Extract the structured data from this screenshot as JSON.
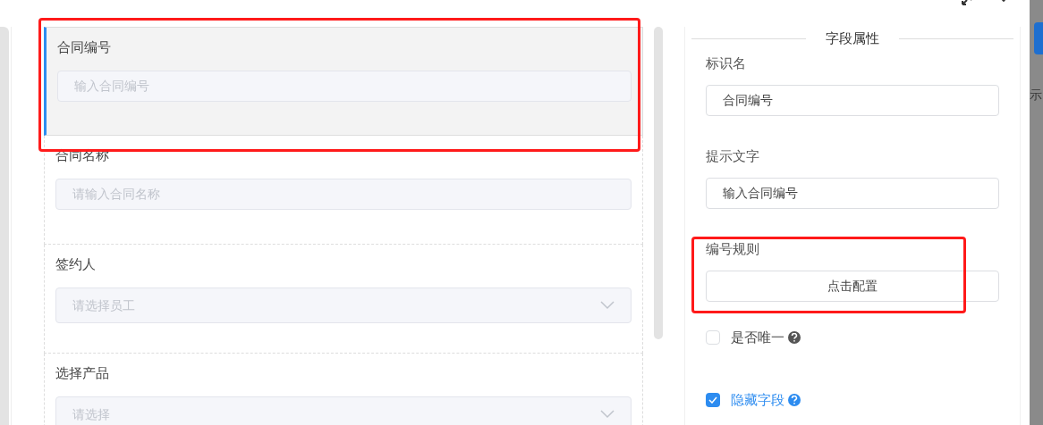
{
  "form_fields": [
    {
      "label": "合同编号",
      "placeholder": "输入合同编号",
      "kind": "input",
      "selected": true
    },
    {
      "label": "合同名称",
      "placeholder": "请输入合同名称",
      "kind": "input",
      "selected": false
    },
    {
      "label": "签约人",
      "placeholder": "请选择员工",
      "kind": "select",
      "selected": false
    },
    {
      "label": "选择产品",
      "placeholder": "请选择",
      "kind": "select",
      "selected": false
    }
  ],
  "properties_panel": {
    "title": "字段属性",
    "properties": [
      {
        "kind": "text",
        "label": "标识名",
        "value": "合同编号"
      },
      {
        "kind": "text",
        "label": "提示文字",
        "value": "输入合同编号"
      },
      {
        "kind": "button",
        "label": "编号规则",
        "value": "点击配置"
      }
    ],
    "checkboxes": [
      {
        "label": "是否唯一",
        "checked": false
      },
      {
        "label": "隐藏字段",
        "checked": true
      }
    ]
  },
  "background_page": {
    "text": "示"
  },
  "annotations": [
    {
      "color": "#ff1a1a"
    },
    {
      "color": "#ff1a1a"
    }
  ]
}
